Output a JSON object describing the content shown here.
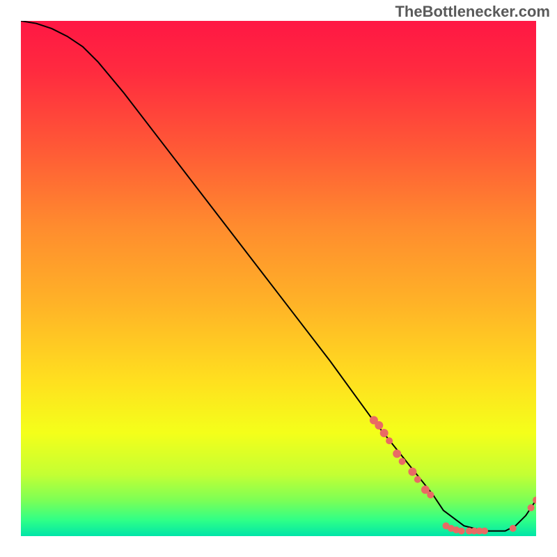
{
  "watermark": "TheBottlenecker.com",
  "chart_data": {
    "type": "line",
    "title": "",
    "xlabel": "",
    "ylabel": "",
    "xlim": [
      0,
      100
    ],
    "ylim": [
      0,
      100
    ],
    "gradient_stops": [
      {
        "offset": 0.0,
        "color": "#ff1744"
      },
      {
        "offset": 0.1,
        "color": "#ff2b3f"
      },
      {
        "offset": 0.25,
        "color": "#ff5a36"
      },
      {
        "offset": 0.4,
        "color": "#ff8c2e"
      },
      {
        "offset": 0.55,
        "color": "#ffb327"
      },
      {
        "offset": 0.7,
        "color": "#ffe01f"
      },
      {
        "offset": 0.8,
        "color": "#f4ff1a"
      },
      {
        "offset": 0.88,
        "color": "#c4ff33"
      },
      {
        "offset": 0.93,
        "color": "#7dff55"
      },
      {
        "offset": 0.97,
        "color": "#2eff88"
      },
      {
        "offset": 1.0,
        "color": "#00e5a8"
      }
    ],
    "series": [
      {
        "name": "curve",
        "type": "line",
        "color": "#000000",
        "x": [
          0,
          3,
          6,
          9,
          12,
          15,
          20,
          30,
          40,
          50,
          60,
          68,
          72,
          76,
          80,
          82,
          86,
          90,
          94,
          96,
          98,
          100
        ],
        "y": [
          100,
          99.5,
          98.5,
          97,
          95,
          92,
          86,
          73,
          60,
          47,
          34,
          23,
          18,
          13,
          8,
          5,
          2,
          1,
          1,
          2,
          4,
          7
        ]
      },
      {
        "name": "markers",
        "type": "scatter",
        "color": "#e96a64",
        "points": [
          {
            "x": 68.5,
            "y": 22.5,
            "r": 6
          },
          {
            "x": 69.5,
            "y": 21.5,
            "r": 6
          },
          {
            "x": 70.5,
            "y": 20.0,
            "r": 6
          },
          {
            "x": 71.5,
            "y": 18.5,
            "r": 5
          },
          {
            "x": 73.0,
            "y": 16.0,
            "r": 6
          },
          {
            "x": 74.0,
            "y": 14.5,
            "r": 5
          },
          {
            "x": 76.0,
            "y": 12.5,
            "r": 6
          },
          {
            "x": 77.0,
            "y": 11.0,
            "r": 5
          },
          {
            "x": 78.5,
            "y": 9.0,
            "r": 6
          },
          {
            "x": 79.5,
            "y": 8.0,
            "r": 5
          },
          {
            "x": 82.5,
            "y": 2.0,
            "r": 5
          },
          {
            "x": 83.5,
            "y": 1.5,
            "r": 5
          },
          {
            "x": 84.5,
            "y": 1.2,
            "r": 5
          },
          {
            "x": 85.5,
            "y": 1.0,
            "r": 5
          },
          {
            "x": 87.0,
            "y": 1.0,
            "r": 5
          },
          {
            "x": 88.0,
            "y": 1.0,
            "r": 5
          },
          {
            "x": 89.0,
            "y": 1.0,
            "r": 5
          },
          {
            "x": 90.0,
            "y": 1.0,
            "r": 5
          },
          {
            "x": 95.5,
            "y": 1.5,
            "r": 5
          },
          {
            "x": 99.0,
            "y": 5.5,
            "r": 5
          },
          {
            "x": 100.0,
            "y": 7.0,
            "r": 5
          }
        ]
      }
    ]
  }
}
